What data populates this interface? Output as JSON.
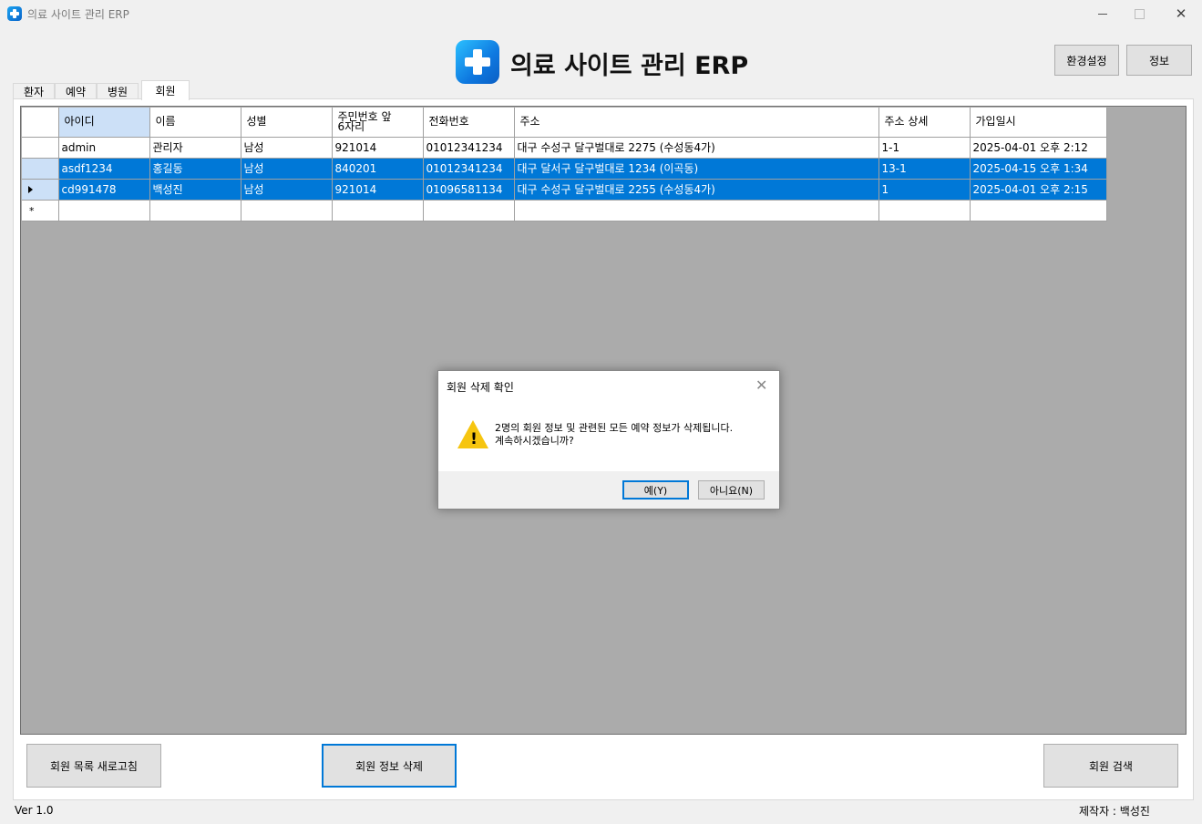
{
  "window": {
    "title": "의료 사이트 관리 ERP",
    "controls": {
      "minimize": "minimize-icon",
      "maximize": "maximize-icon",
      "close": "✕"
    }
  },
  "header": {
    "app_title": "의료 사이트 관리 ERP",
    "logo_icon": "medical-cross-icon",
    "settings_label": "환경설정",
    "info_label": "정보"
  },
  "tabs": [
    {
      "label": "환자",
      "active": false
    },
    {
      "label": "예약",
      "active": false
    },
    {
      "label": "병원",
      "active": false
    },
    {
      "label": "회원",
      "active": true
    }
  ],
  "grid": {
    "columns": [
      "아이디",
      "이름",
      "성별",
      "주민번호 앞\n6자리",
      "전화번호",
      "주소",
      "주소 상세",
      "가입일시"
    ],
    "rows": [
      {
        "selected": false,
        "current": false,
        "cells": [
          "admin",
          "관리자",
          "남성",
          "921014",
          "01012341234",
          "대구 수성구 달구벌대로 2275 (수성동4가)",
          "1-1",
          "2025-04-01 오후 2:12"
        ]
      },
      {
        "selected": true,
        "current": false,
        "cells": [
          "asdf1234",
          "홍길동",
          "남성",
          "840201",
          "01012341234",
          "대구 달서구 달구벌대로 1234 (이곡동)",
          "13-1",
          "2025-04-15 오후 1:34"
        ]
      },
      {
        "selected": true,
        "current": true,
        "cells": [
          "cd991478",
          "백성진",
          "남성",
          "921014",
          "01096581134",
          "대구 수성구 달구벌대로 2255 (수성동4가)",
          "1",
          "2025-04-01 오후 2:15"
        ]
      }
    ],
    "new_row_marker": "*"
  },
  "buttons": {
    "refresh": "회원 목록 새로고침",
    "delete": "회원 정보 삭제",
    "search": "회원 검색"
  },
  "footer": {
    "version": "Ver 1.0",
    "author": "제작자 : 백성진"
  },
  "dialog": {
    "title": "회원 삭제 확인",
    "close": "✕",
    "icon": "warning-icon",
    "warn_mark": "!",
    "message_line1": "2명의 회원 정보 및 관련된 모든 예약 정보가 삭제됩니다.",
    "message_line2": "계속하시겠습니까?",
    "yes_label": "예(Y)",
    "no_label": "아니요(N)"
  },
  "colors": {
    "selection": "#0078d7",
    "selection_header": "#cce0f7",
    "grid_background": "#ababab",
    "warning": "#f6c510"
  }
}
